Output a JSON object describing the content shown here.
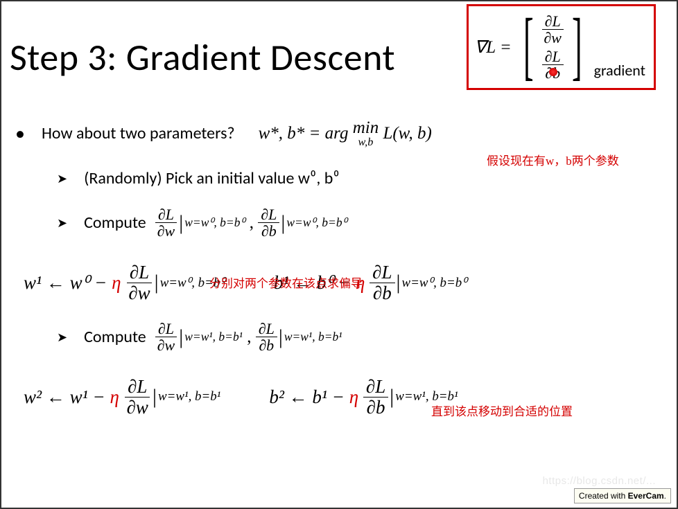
{
  "title": "Step 3: Gradient Descent",
  "gradbox": {
    "nabla": "∇L =",
    "row1_num": "∂L",
    "row1_den": "∂w",
    "row2_num": "∂L",
    "row2_den": "∂b",
    "label": "gradient"
  },
  "q": {
    "text": "How about two parameters?",
    "eq_lhs": "w*, b* = arg",
    "eq_min": "min",
    "eq_min_sub": "w,b",
    "eq_rhs": "L(w, b)"
  },
  "step1": "(Randomly) Pick an initial value w⁰, b⁰",
  "step2": {
    "label": "Compute",
    "f1_num": "∂L",
    "f1_den": "∂w",
    "eval1": "w=w⁰, b=b⁰",
    "f2_num": "∂L",
    "f2_den": "∂b",
    "eval2": "w=w⁰, b=b⁰"
  },
  "update1": {
    "w_lhs": "w¹ ← w⁰ −",
    "eta": "η",
    "wf_num": "∂L",
    "wf_den": "∂w",
    "w_eval": "w=w⁰, b=b⁰",
    "b_lhs": "b¹ ← b⁰ −",
    "bf_num": "∂L",
    "bf_den": "∂b",
    "b_eval": "w=w⁰, b=b⁰"
  },
  "step3": {
    "label": "Compute",
    "f1_num": "∂L",
    "f1_den": "∂w",
    "eval1": "w=w¹, b=b¹",
    "f2_num": "∂L",
    "f2_den": "∂b",
    "eval2": "w=w¹, b=b¹"
  },
  "update2": {
    "w_lhs": "w² ← w¹ −",
    "eta": "η",
    "wf_num": "∂L",
    "wf_den": "∂w",
    "w_eval": "w=w¹, b=b¹",
    "b_lhs": "b² ← b¹ −",
    "bf_num": "∂L",
    "bf_den": "∂b",
    "b_eval": "w=w¹, b=b¹"
  },
  "anno": {
    "a1": "假设现在有w，b两个参数",
    "a2": "分别对两个参数在该点求偏导",
    "a3": "直到该点移动到合适的位置"
  },
  "footer": {
    "pre": "Created with ",
    "b": "EverCam",
    "post": "."
  },
  "watermark": "https://blog.csdn.net/..."
}
